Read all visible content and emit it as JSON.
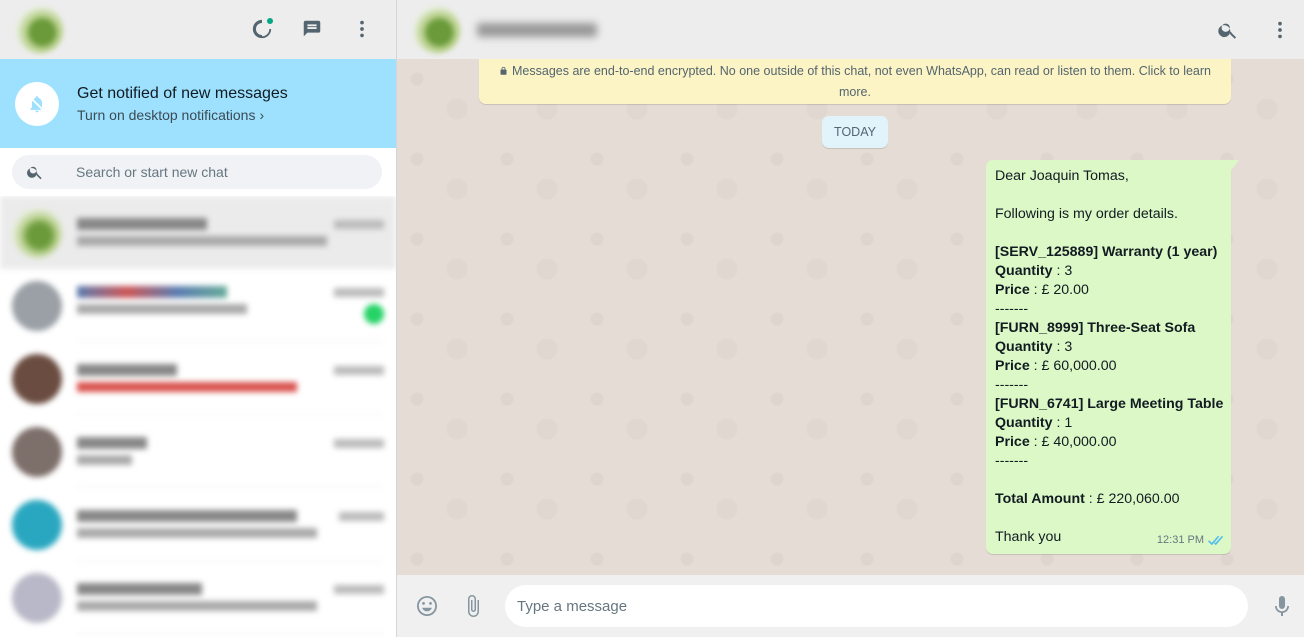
{
  "left_header": {
    "icons": [
      "status-icon",
      "new-chat-icon",
      "menu-icon"
    ]
  },
  "notification": {
    "title": "Get notified of new messages",
    "link": "Turn on desktop notifications",
    "chevron": "›"
  },
  "search": {
    "placeholder": "Search or start new chat"
  },
  "chat_list": [
    {
      "avatar_color": "#8fb665",
      "active": true
    },
    {
      "avatar_color": "#9aa0a6",
      "active": false,
      "unread": true
    },
    {
      "avatar_color": "#6b4c40",
      "active": false
    },
    {
      "avatar_color": "#7d6f6a",
      "active": false
    },
    {
      "avatar_color": "#2aa7c0",
      "active": false
    },
    {
      "avatar_color": "#b9b8c8",
      "active": false
    }
  ],
  "conversation": {
    "encryption_notice": "Messages are end-to-end encrypted. No one outside of this chat, not even WhatsApp, can read or listen to them. Click to learn more.",
    "day_label": "TODAY",
    "message": {
      "greeting": "Dear Joaquin Tomas,",
      "intro": "Following is my order details.",
      "items": [
        {
          "title": "[SERV_125889] Warranty (1 year)",
          "qty_label": "Quantity",
          "qty": " : 3",
          "price_label": "Price",
          "price": " : £ 20.00"
        },
        {
          "title": "[FURN_8999] Three-Seat Sofa",
          "qty_label": "Quantity",
          "qty": " : 3",
          "price_label": "Price",
          "price": " : £ 60,000.00"
        },
        {
          "title": "[FURN_6741] Large Meeting Table",
          "qty_label": "Quantity",
          "qty": " : 1",
          "price_label": "Price",
          "price": " : £ 40,000.00"
        }
      ],
      "separator": "-------",
      "total_label": "Total Amount",
      "total": " : £ 220,060.00",
      "closing": "Thank you",
      "time": "12:31 PM"
    }
  },
  "composer": {
    "placeholder": "Type a message"
  }
}
